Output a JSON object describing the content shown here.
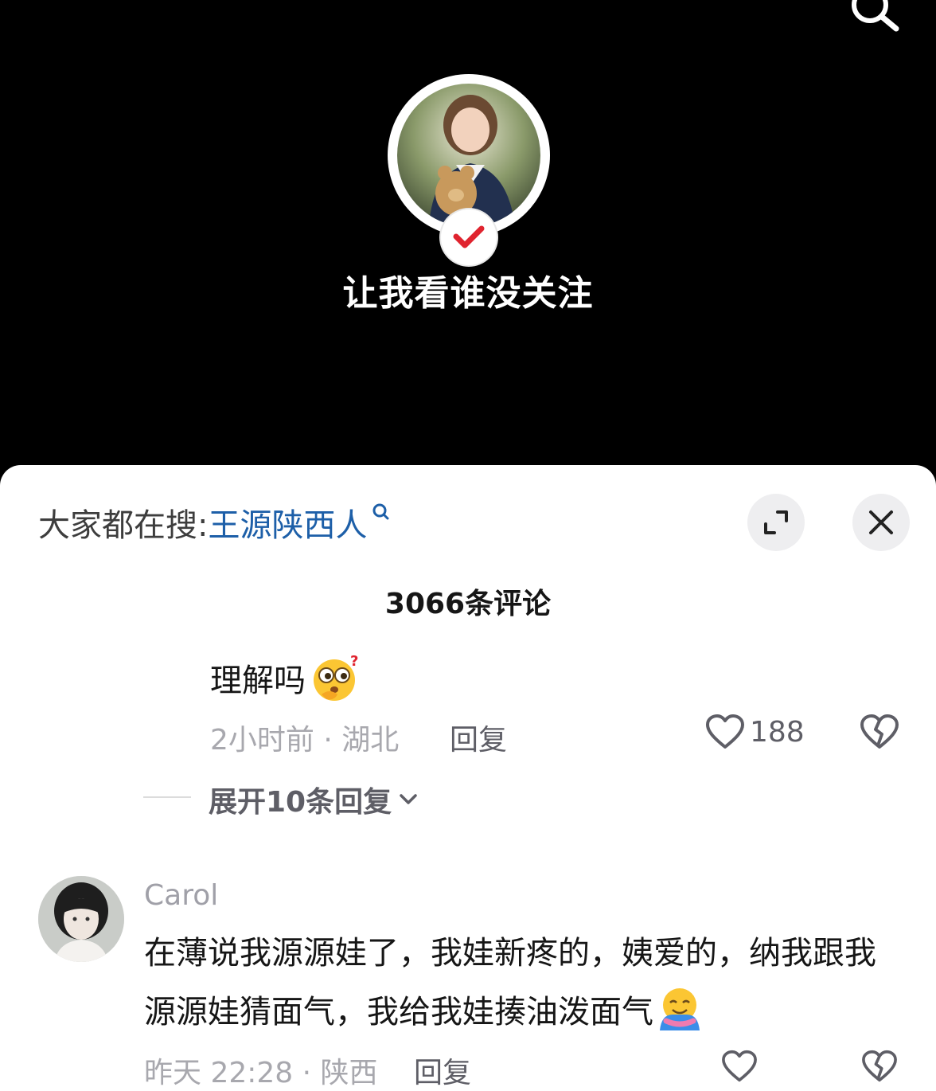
{
  "video": {
    "caption": "让我看谁没关注",
    "search_icon": "search-icon",
    "verified_icon": "check-icon"
  },
  "sheet": {
    "trending_prefix": "大家都在搜:",
    "trending_term": "王源陕西人",
    "expand_icon": "expand-icon",
    "close_icon": "close-icon",
    "comment_count": "3066条评论"
  },
  "comments": [
    {
      "text": "理解吗",
      "emoji": "thinking-face-emoji",
      "time_location": "2小时前 · 湖北",
      "reply_label": "回复",
      "likes": "188",
      "expand_label": "展开10条回复"
    },
    {
      "author": "Carol",
      "text": "在薄说我源源娃了，我娃新疼的，姨爱的，纳我跟我源源娃猜面气，我给我娃揍油泼面气",
      "emoji": "hugging-face-emoji",
      "time_location": "昨天 22:28 · 陕西",
      "reply_label": "回复"
    }
  ],
  "colors": {
    "link": "#1d5fa8",
    "muted": "#a8a8ae",
    "accent_check": "#e0242f"
  }
}
